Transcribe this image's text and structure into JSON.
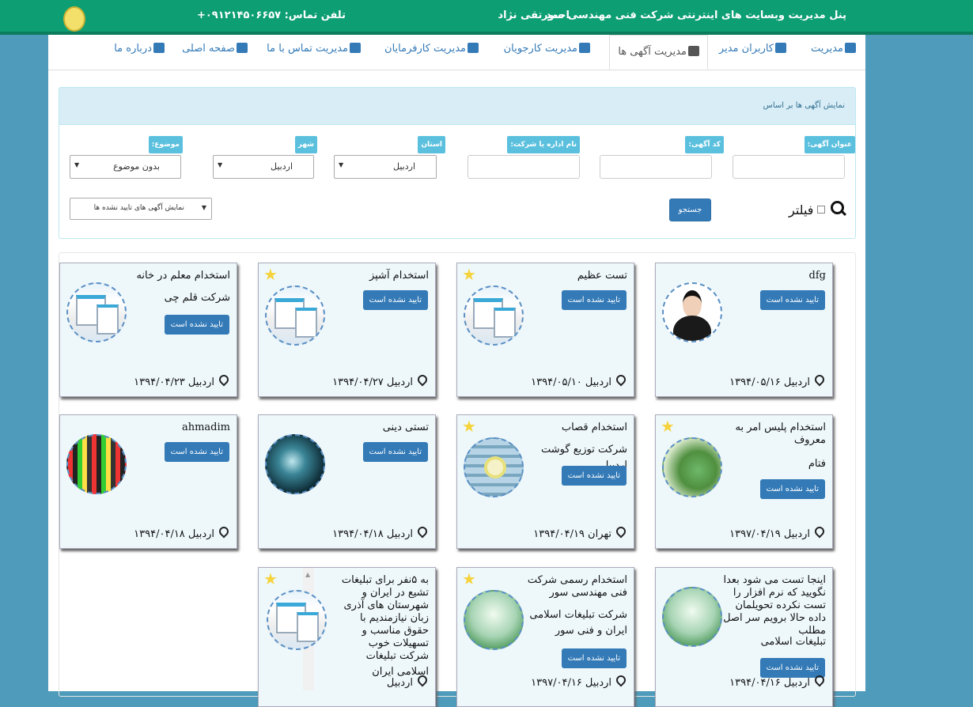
{
  "topbar": {
    "title": "پنل مدیریت وبسایت های اینترنتی شرکت فنی مهندسی سور",
    "user": "احمد تقی نژاد",
    "phone": "تلفن تماس: ۰۹۱۲۱۴۵۰۶۶۵۷+"
  },
  "tabs": [
    {
      "label": "مدیریت"
    },
    {
      "label": "کاربران مدیر"
    },
    {
      "label": "مدیریت آگهی ها"
    },
    {
      "label": "مدیریت کارجویان"
    },
    {
      "label": "مدیریت کارفرمایان"
    },
    {
      "label": "مدیریت تماس با ما"
    },
    {
      "label": "صفحه اصلی"
    },
    {
      "label": "درباره ما"
    }
  ],
  "filter": {
    "header": "نمایش آگهی ها بر اساس",
    "title_label": "عنوان آگهی:",
    "code_label": "کد آگهی:",
    "company_label": "نام اداره یا شرکت:",
    "province_label": "استان",
    "province_value": "اردبیل",
    "city_label": "شهر",
    "city_value": "اردبیل",
    "topic_label": "موضوع:",
    "topic_value": "بدون موضوع",
    "checkbox_label": "فیلتر",
    "search_button": "جستجو",
    "status_value": "نمایش آگهی های تایید نشده ها"
  },
  "cards": [
    {
      "title": "dfg",
      "company": "",
      "status": "تایید نشده است",
      "location": "اردبیل ۱۳۹۴/۰۵/۱۶",
      "image": "avatar-icon",
      "starred": false
    },
    {
      "title": "تست عظیم",
      "company": "",
      "status": "تایید نشده است",
      "location": "اردبیل ۱۳۹۴/۰۵/۱۰",
      "image": "app-screens-icon",
      "starred": true
    },
    {
      "title": "استخدام آشپز",
      "company": "",
      "status": "تایید نشده است",
      "location": "اردبیل ۱۳۹۴/۰۴/۲۷",
      "image": "app-screens-icon",
      "starred": true
    },
    {
      "title": "استخدام معلم در خانه",
      "company": "شرکت قلم چی",
      "status": "تایید نشده است",
      "location": "اردبیل ۱۳۹۴/۰۴/۲۳",
      "image": "app-screens-icon",
      "starred": false
    },
    {
      "title": "استخدام پلیس امر به معروف",
      "company": "فتام",
      "status": "تایید نشده است",
      "location": "اردبیل ۱۳۹۷/۰۴/۱۹",
      "image": "green-leaves-icon",
      "starred": true
    },
    {
      "title": "استخدام قصاب",
      "company": "شرکت توزیع گوشت اردبیل",
      "status": "تایید نشده است",
      "location": "تهران ۱۳۹۴/۰۴/۱۹",
      "image": "flowers-icon",
      "starred": true
    },
    {
      "title": "تستی دینی",
      "company": "",
      "status": "تایید نشده است",
      "location": "اردبیل ۱۳۹۴/۰۴/۱۸",
      "image": "hand-icon",
      "starred": false
    },
    {
      "title": "ahmadim",
      "company": "",
      "status": "تایید نشده است",
      "location": "اردبیل ۱۳۹۴/۰۴/۱۸",
      "image": "pixel-art-icon",
      "starred": false
    },
    {
      "title": "اینجا تست می شود بعدا نگویید که نرم افزار را تست نکرده تحویلمان داده حالا برویم سر اصل مطلب",
      "company": "تبلیغات اسلامی",
      "status": "تایید نشده است",
      "location": "اردبیل ۱۳۹۴/۰۴/۱۶",
      "image": "mist-icon",
      "starred": false
    },
    {
      "title": "استخدام رسمی شرکت فنی مهندسی سور",
      "company": "شرکت تبلیغات اسلامی ایران و فنی سور",
      "status": "تایید نشده است",
      "location": "اردبیل ۱۳۹۷/۰۴/۱۶",
      "image": "mist-icon",
      "starred": true
    },
    {
      "title": "به ۵نفر برای تبلیغات تشیع در ایران و شهرستان های آذری زبان نیازمندیم با حقوق مناسب و تسهیلات خوب",
      "company": "شرکت تبلیغات اسلامی ایران",
      "status": "",
      "location": "اردبیل",
      "image": "app-screens-icon",
      "starred": true
    }
  ]
}
